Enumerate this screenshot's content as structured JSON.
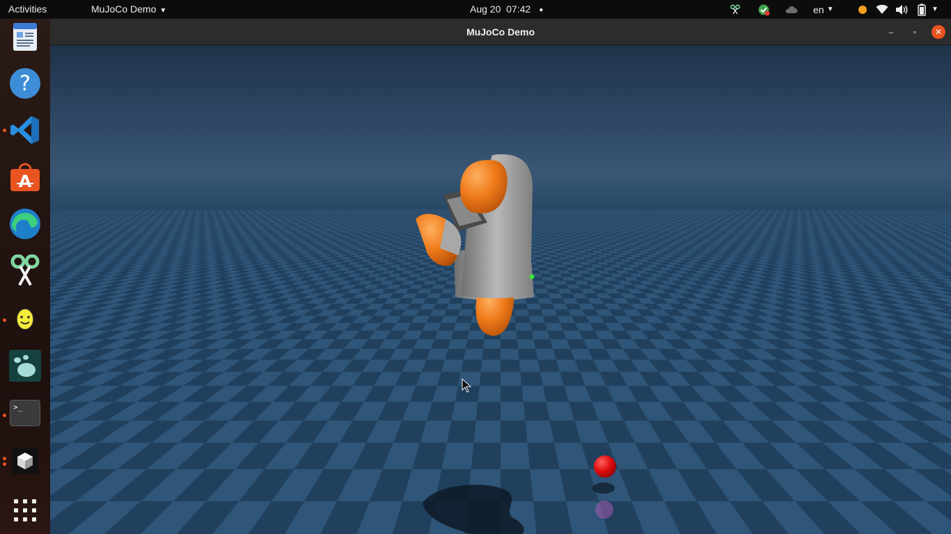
{
  "topbar": {
    "activities": "Activities",
    "app_menu": "MuJoCo Demo",
    "date": "Aug 20",
    "time": "07:42",
    "language": "en"
  },
  "dock": {
    "items": [
      {
        "name": "text-editor",
        "icon": "document-icon",
        "running": false
      },
      {
        "name": "help",
        "icon": "help-icon",
        "running": false
      },
      {
        "name": "vscode",
        "icon": "vscode-icon",
        "running": true
      },
      {
        "name": "software-center",
        "icon": "shopping-bag-icon",
        "running": false
      },
      {
        "name": "edge-browser",
        "icon": "edge-icon",
        "running": false
      },
      {
        "name": "screenshot-tool",
        "icon": "scissors-icon",
        "running": false
      },
      {
        "name": "egg-app",
        "icon": "egg-face-icon",
        "running": true
      },
      {
        "name": "paw-app",
        "icon": "paw-icon",
        "running": false
      },
      {
        "name": "terminal",
        "icon": "terminal-icon",
        "running": true
      },
      {
        "name": "3d-app",
        "icon": "cube-icon",
        "running": true
      },
      {
        "name": "show-applications",
        "icon": "grid-icon",
        "running": false
      }
    ],
    "terminal_prompt": ">_"
  },
  "window": {
    "title": "MuJoCo Demo",
    "minimize_glyph": "–",
    "maximize_glyph": "▫",
    "close_glyph": "✕"
  },
  "scene": {
    "sky_top_color": "#1f324a",
    "sky_horizon_color": "#3a5876",
    "floor_color_a": "#2f5578",
    "floor_color_b": "#20405e",
    "robot_link_color": "#9a9a9a",
    "robot_joint_color": "#ef7a1a",
    "target_ball_color": "#e01010",
    "marker_color": "#39e639"
  },
  "colors": {
    "accent": "#e95420",
    "topbar_bg": "#0c0c0c",
    "titlebar_bg": "#2c2c2c"
  }
}
